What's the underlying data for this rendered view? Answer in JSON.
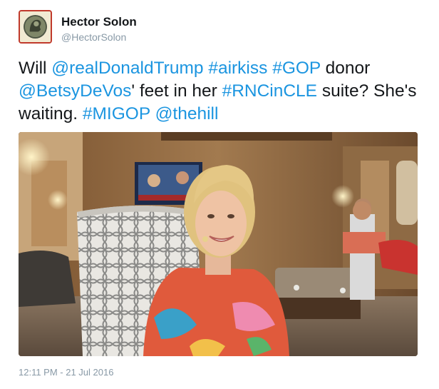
{
  "tweet": {
    "author": {
      "display_name": "Hector Solon",
      "handle": "@HectorSolon",
      "avatar_icon": "coin-portrait-icon"
    },
    "text_segments": [
      {
        "text": "Will ",
        "type": "text"
      },
      {
        "text": "@realDonaldTrump",
        "type": "mention"
      },
      {
        "text": " ",
        "type": "text"
      },
      {
        "text": "#airkiss",
        "type": "hashtag"
      },
      {
        "text": " ",
        "type": "text"
      },
      {
        "text": "#GOP",
        "type": "hashtag"
      },
      {
        "text": " donor ",
        "type": "text"
      },
      {
        "text": "@BetsyDeVos",
        "type": "mention"
      },
      {
        "text": "' feet in her ",
        "type": "text"
      },
      {
        "text": "#RNCinCLE",
        "type": "hashtag"
      },
      {
        "text": " suite? She's waiting. ",
        "type": "text"
      },
      {
        "text": "#MIGOP",
        "type": "hashtag"
      },
      {
        "text": " ",
        "type": "text"
      },
      {
        "text": "@thehill",
        "type": "mention"
      }
    ],
    "timestamp": "12:11 PM - 21 Jul 2016"
  },
  "colors": {
    "link": "#1b95e0",
    "text": "#14171a",
    "secondary": "#8899a6",
    "avatar_border": "#c0392b"
  }
}
